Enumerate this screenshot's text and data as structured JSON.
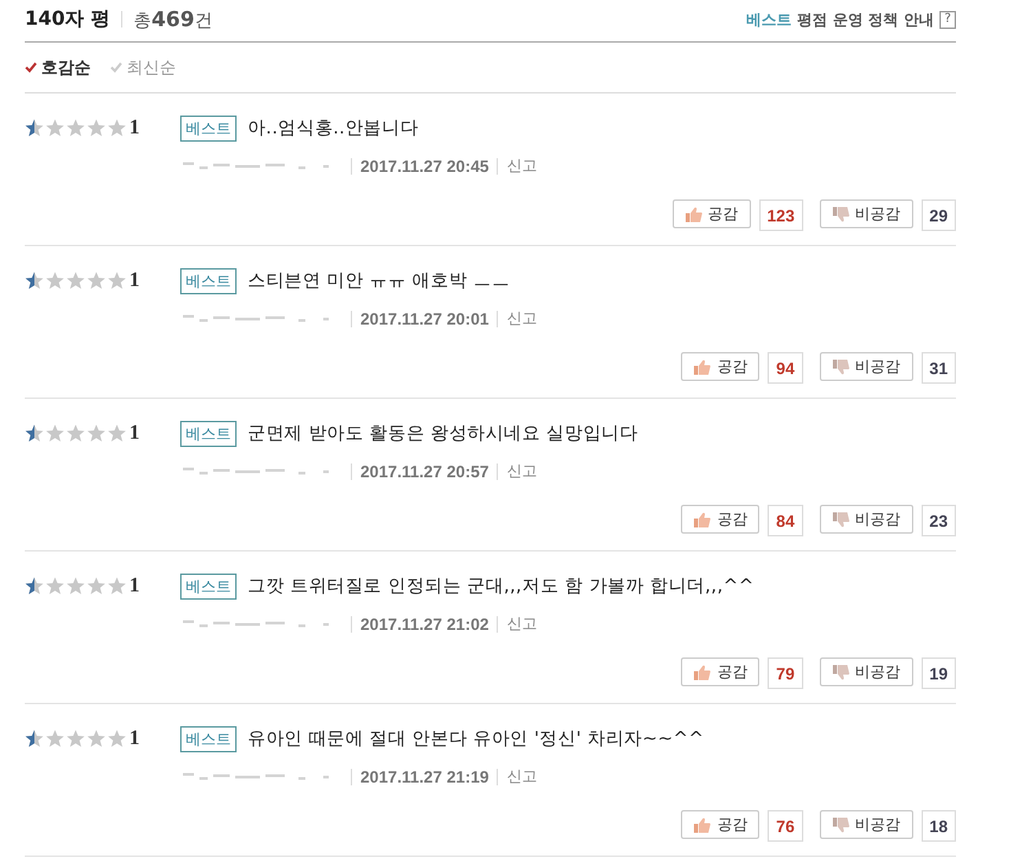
{
  "header": {
    "title": "140자 평",
    "total_prefix": "총",
    "total_count": "469",
    "total_suffix": "건",
    "policy_best": "베스트",
    "policy_text": "평점 운영 정책 안내",
    "help": "?"
  },
  "sort_options": [
    {
      "label": "호감순",
      "selected": true
    },
    {
      "label": "최신순",
      "selected": false
    }
  ],
  "reviews": [
    {
      "stars": 0.5,
      "score": "1",
      "badge": "베스트",
      "text": "아..엄식홍..안봅니다",
      "date": "2017.11.27 20:45",
      "report": "신고",
      "like_label": "공감",
      "likes": "123",
      "dislike_label": "비공감",
      "dislikes": "29"
    },
    {
      "stars": 0.5,
      "score": "1",
      "badge": "베스트",
      "text": "스티븐연 미안 ㅠㅠ 애호박 ㅡㅡ",
      "date": "2017.11.27 20:01",
      "report": "신고",
      "like_label": "공감",
      "likes": "94",
      "dislike_label": "비공감",
      "dislikes": "31"
    },
    {
      "stars": 0.5,
      "score": "1",
      "badge": "베스트",
      "text": "군면제 받아도 활동은 왕성하시네요 실망입니다",
      "date": "2017.11.27 20:57",
      "report": "신고",
      "like_label": "공감",
      "likes": "84",
      "dislike_label": "비공감",
      "dislikes": "23"
    },
    {
      "stars": 0.5,
      "score": "1",
      "badge": "베스트",
      "text": "그깟 트위터질로 인정되는 군대,,,저도 함 가볼까 합니더,,,^^",
      "date": "2017.11.27 21:02",
      "report": "신고",
      "like_label": "공감",
      "likes": "79",
      "dislike_label": "비공감",
      "dislikes": "19"
    },
    {
      "stars": 0.5,
      "score": "1",
      "badge": "베스트",
      "text": "유아인 때문에 절대 안본다 유아인 '정신' 차리자~~^^",
      "date": "2017.11.27 21:19",
      "report": "신고",
      "like_label": "공감",
      "likes": "76",
      "dislike_label": "비공감",
      "dislikes": "18"
    }
  ]
}
